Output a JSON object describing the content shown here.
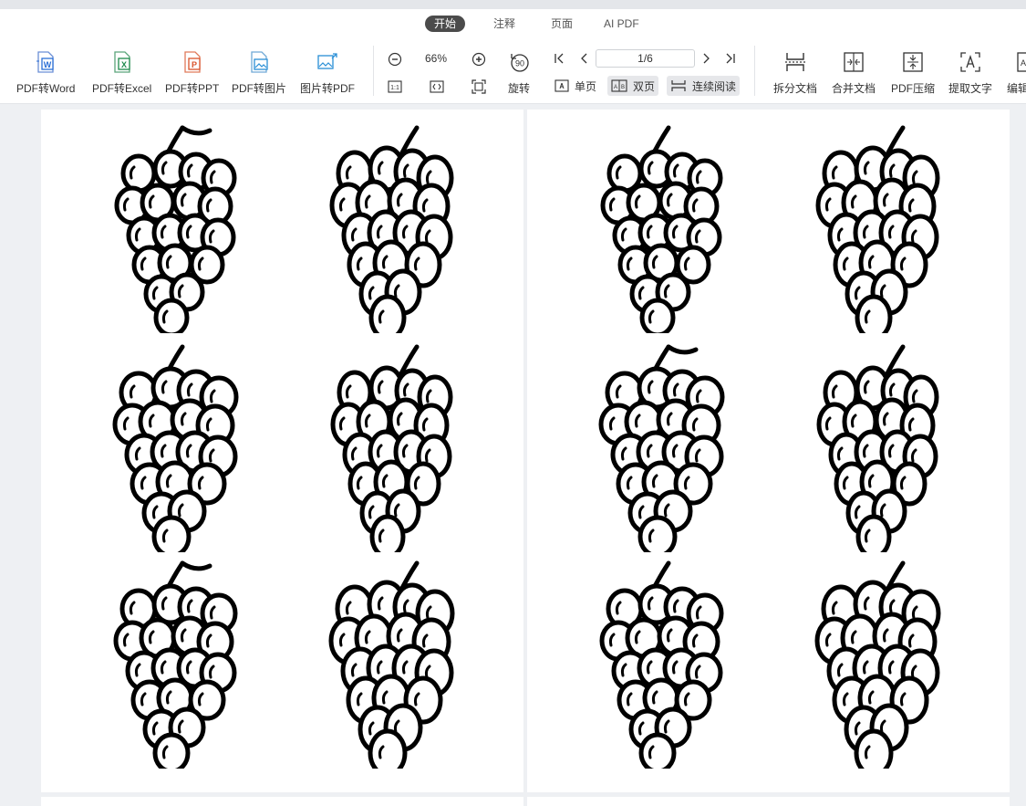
{
  "tabs": [
    {
      "label": "开始",
      "active": true
    },
    {
      "label": "注释",
      "active": false
    },
    {
      "label": "页面",
      "active": false
    },
    {
      "label": "AI PDF",
      "active": false
    }
  ],
  "convert_tools": [
    {
      "label": "PDF转Word",
      "icon": "pdf-to-word-icon",
      "color": "#2b6fd6"
    },
    {
      "label": "PDF转Excel",
      "icon": "pdf-to-excel-icon",
      "color": "#1e8a4c"
    },
    {
      "label": "PDF转PPT",
      "icon": "pdf-to-ppt-icon",
      "color": "#d9532b"
    },
    {
      "label": "PDF转图片",
      "icon": "pdf-to-image-icon",
      "color": "#2a8fd6"
    },
    {
      "label": "图片转PDF",
      "icon": "image-to-pdf-icon",
      "color": "#2a8fd6"
    }
  ],
  "zoom": {
    "value": "66%",
    "zoom_out_icon": "minus-circle-icon",
    "zoom_in_icon": "plus-circle-icon",
    "actual_size_icon": "actual-size-icon",
    "fit_width_icon": "fit-width-icon",
    "fit_page_icon": "fit-page-icon"
  },
  "rotate": {
    "label": "旋转",
    "icon": "rotate-90-icon",
    "icon_text": "90"
  },
  "navigation": {
    "page_value": "1/6",
    "first_icon": "first-page-icon",
    "prev_icon": "prev-page-icon",
    "next_icon": "next-page-icon",
    "last_icon": "last-page-icon"
  },
  "view_modes": [
    {
      "label": "单页",
      "icon": "single-page-icon",
      "selected": false
    },
    {
      "label": "双页",
      "icon": "double-page-icon",
      "selected": true
    },
    {
      "label": "连续阅读",
      "icon": "continuous-read-icon",
      "selected": true
    }
  ],
  "right_tools": [
    {
      "label": "拆分文档",
      "icon": "split-doc-icon"
    },
    {
      "label": "合并文档",
      "icon": "merge-doc-icon"
    },
    {
      "label": "PDF压缩",
      "icon": "compress-icon"
    },
    {
      "label": "提取文字",
      "icon": "extract-text-icon"
    },
    {
      "label": "编辑",
      "icon": "edit-icon"
    }
  ],
  "document": {
    "pages_visible": 2,
    "illustrations_per_page": 6,
    "illustration_subject": "grape-bunch-icon"
  },
  "colors": {
    "accent_tab": "#4b4b4b",
    "canvas_bg": "#eef0f3",
    "page_bg": "#ffffff",
    "line_art": "#000000"
  }
}
